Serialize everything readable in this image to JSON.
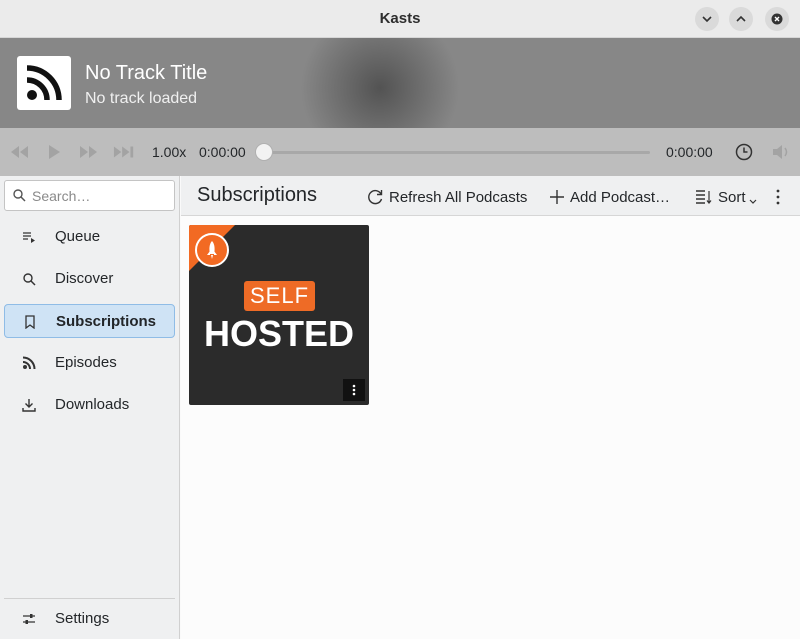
{
  "window": {
    "title": "Kasts",
    "minimize_icon": "chevron-down-icon",
    "maximize_icon": "chevron-up-icon",
    "close_icon": "close-icon"
  },
  "now_playing": {
    "cover_icon": "rss-icon",
    "title": "No Track Title",
    "subtitle": "No track loaded"
  },
  "player": {
    "speed": "1.00x",
    "position": "0:00:00",
    "duration": "0:00:00",
    "progress": 0,
    "buttons": [
      "skip-back-icon",
      "play-icon",
      "skip-forward-icon",
      "next-icon",
      "sleep-timer-icon",
      "volume-icon"
    ]
  },
  "sidebar": {
    "search_placeholder": "Search…",
    "items": [
      {
        "label": "Queue",
        "icon": "queue-icon",
        "active": false
      },
      {
        "label": "Discover",
        "icon": "search-icon",
        "active": false
      },
      {
        "label": "Subscriptions",
        "icon": "bookmark-icon",
        "active": true
      },
      {
        "label": "Episodes",
        "icon": "rss-icon",
        "active": false
      },
      {
        "label": "Downloads",
        "icon": "download-icon",
        "active": false
      }
    ],
    "settings_label": "Settings"
  },
  "toolbar": {
    "title": "Subscriptions",
    "refresh_label": "Refresh All Podcasts",
    "add_label": "Add Podcast…",
    "sort_label": "Sort"
  },
  "subscriptions": [
    {
      "line1": "SELF",
      "line2": "HOSTED"
    }
  ],
  "colors": {
    "accent": "#3daee9",
    "header_bg": "#878787",
    "player_bg": "#bdbdbd",
    "podcast_orange": "#f26a23"
  }
}
